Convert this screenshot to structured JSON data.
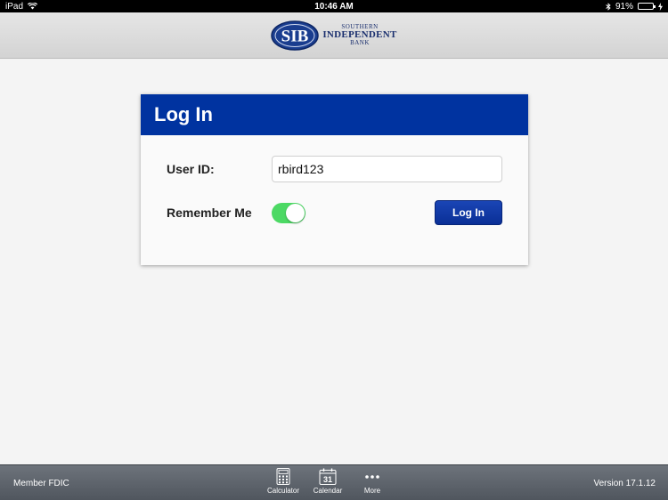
{
  "status_bar": {
    "device": "iPad",
    "time": "10:46 AM",
    "battery": "91%",
    "battery_level": 0.91
  },
  "header": {
    "logo_mark": "SIB",
    "logo_line1": "SOUTHERN",
    "logo_line2": "INDEPENDENT",
    "logo_line3": "BANK"
  },
  "login": {
    "title": "Log In",
    "user_id_label": "User ID:",
    "user_id_value": "rbird123",
    "remember_label": "Remember Me",
    "remember_on": true,
    "button_label": "Log In"
  },
  "tab_bar": {
    "left_text": "Member FDIC",
    "right_text": "Version 17.1.12",
    "calendar_day": "31",
    "items": [
      {
        "label": "Calculator",
        "icon": "calculator-icon"
      },
      {
        "label": "Calendar",
        "icon": "calendar-icon"
      },
      {
        "label": "More",
        "icon": "more-icon"
      }
    ]
  },
  "colors": {
    "brand_blue": "#0033a0",
    "toggle_green": "#4cd964"
  }
}
